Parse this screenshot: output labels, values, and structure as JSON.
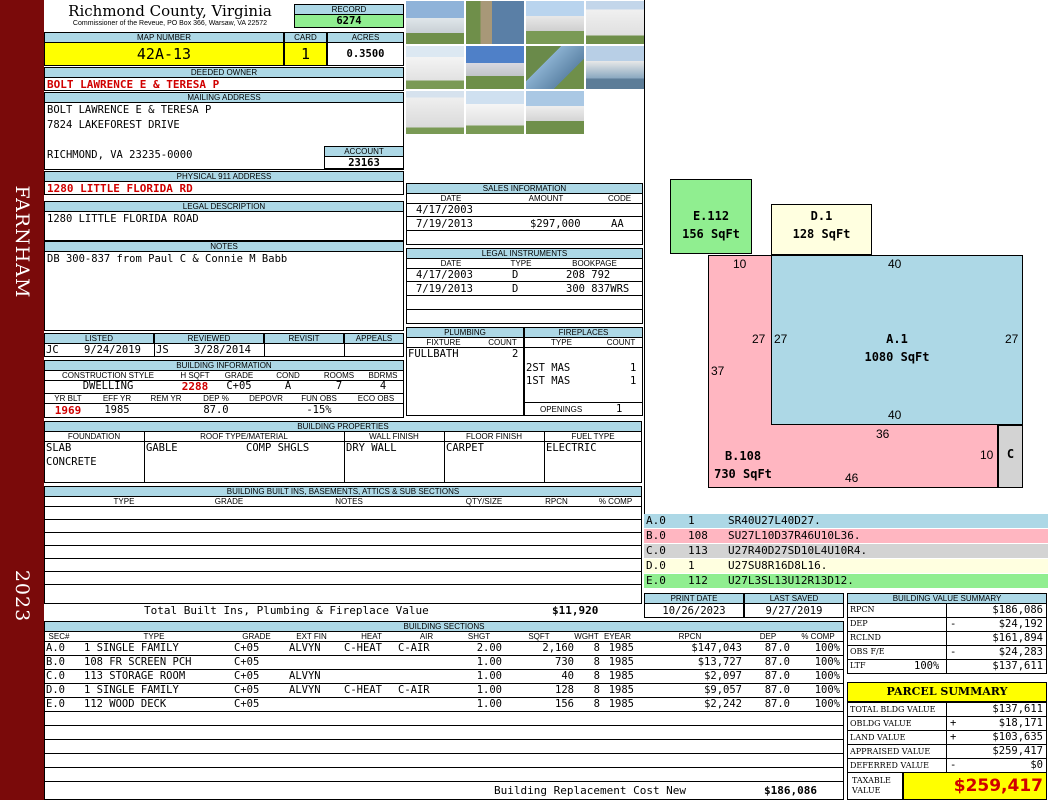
{
  "county": {
    "title": "Richmond County, Virginia",
    "subtitle": "Commissioner of the Reveue, PO Box 366, Warsaw, VA 22572"
  },
  "sidebar": {
    "district": "FARNHAM",
    "year": "2023"
  },
  "record": {
    "label": "RECORD",
    "value": "6274"
  },
  "map": {
    "label": "MAP NUMBER",
    "value": "42A-13",
    "card_label": "CARD",
    "card": "1",
    "acres_label": "ACRES",
    "acres": "0.3500"
  },
  "owner": {
    "label": "DEEDED OWNER",
    "value": "BOLT LAWRENCE E & TERESA P"
  },
  "mailing": {
    "label": "MAILING ADDRESS",
    "line1": "BOLT LAWRENCE E & TERESA P",
    "line2": "7824 LAKEFOREST DRIVE",
    "line3": "RICHMOND, VA 23235-0000"
  },
  "account": {
    "label": "ACCOUNT",
    "value": "23163"
  },
  "physical": {
    "label": "PHYSICAL 911 ADDRESS",
    "value": "1280 LITTLE FLORIDA RD"
  },
  "legal": {
    "label": "LEGAL DESCRIPTION",
    "value": "1280 LITTLE FLORIDA ROAD"
  },
  "notes": {
    "label": "NOTES",
    "value": "DB 300-837 from Paul C & Connie M Babb"
  },
  "listing": {
    "listed_label": "LISTED",
    "reviewed_label": "REVIEWED",
    "revisit_label": "REVISIT",
    "appeals_label": "APPEALS",
    "listed_by": "JC",
    "listed_date": "9/24/2019",
    "reviewed_by": "JS",
    "reviewed_date": "3/28/2014"
  },
  "building_info": {
    "label": "BUILDING INFORMATION",
    "h_style": "CONSTRUCTION STYLE",
    "h_hsqft": "H SQFT",
    "h_grade": "GRADE",
    "h_cond": "COND",
    "h_rooms": "ROOMS",
    "h_bdrms": "BDRMS",
    "style": "DWELLING",
    "hsqft": "2288",
    "grade": "C+05",
    "cond": "A",
    "rooms": "7",
    "bdrms": "4",
    "h_yrblt": "YR BLT",
    "h_effyr": "EFF YR",
    "h_remyr": "REM YR",
    "h_dep": "DEP %",
    "h_depovr": "DEPOVR",
    "h_funobs": "FUN OBS",
    "h_ecoobs": "ECO OBS",
    "yrblt": "1969",
    "effyr": "1985",
    "dep": "87.0",
    "funobs": "-15%"
  },
  "building_props": {
    "label": "BUILDING PROPERTIES",
    "h_found": "FOUNDATION",
    "h_roof": "ROOF TYPE/MATERIAL",
    "h_wall": "WALL FINISH",
    "h_floor": "FLOOR FINISH",
    "h_fuel": "FUEL TYPE",
    "found1": "SLAB",
    "found2": "CONCRETE",
    "roof_type": "GABLE",
    "roof_mat": "COMP SHGLS",
    "wall": "DRY WALL",
    "floor": "CARPET",
    "fuel": "ELECTRIC"
  },
  "builtins": {
    "label": "BUILDING BUILT INS, BASEMENTS, ATTICS & SUB SECTIONS",
    "h_type": "TYPE",
    "h_grade": "GRADE",
    "h_notes": "NOTES",
    "h_qty": "QTY/SIZE",
    "h_rpcn": "RPCN",
    "h_comp": "% COMP",
    "total_label": "Total Built Ins, Plumbing & Fireplace Value",
    "total": "$11,920"
  },
  "sales": {
    "label": "SALES INFORMATION",
    "h_date": "DATE",
    "h_amount": "AMOUNT",
    "h_code": "CODE",
    "rows": [
      {
        "date": "4/17/2003",
        "amount": "",
        "code": ""
      },
      {
        "date": "7/19/2013",
        "amount": "$297,000",
        "code": "AA"
      }
    ]
  },
  "instruments": {
    "label": "LEGAL INSTRUMENTS",
    "h_date": "DATE",
    "h_type": "TYPE",
    "h_book": "BOOKPAGE",
    "rows": [
      {
        "date": "4/17/2003",
        "type": "D",
        "book": "208 792"
      },
      {
        "date": "7/19/2013",
        "type": "D",
        "book": "300 837WRS"
      }
    ]
  },
  "plumbing": {
    "label": "PLUMBING",
    "h_fixture": "FIXTURE",
    "h_count": "COUNT",
    "fixture": "FULLBATH",
    "count": "2"
  },
  "fireplaces": {
    "label": "FIREPLACES",
    "h_type": "TYPE",
    "h_count": "COUNT",
    "rows": [
      {
        "type": "2ST MAS",
        "count": "1"
      },
      {
        "type": "1ST MAS",
        "count": "1"
      }
    ],
    "openings_label": "OPENINGS",
    "openings": "1"
  },
  "sketch": {
    "areas": [
      {
        "label": "E.112",
        "sqft": "156 SqFt",
        "color": "#90ee90"
      },
      {
        "label": "D.1",
        "sqft": "128 SqFt",
        "color": "#ffffe0"
      },
      {
        "label": "A.1",
        "sqft": "1080 SqFt",
        "color": "#add8e6"
      },
      {
        "label": "B.108",
        "sqft": "730 SqFt",
        "color": "#ffb6c1"
      },
      {
        "label": "C",
        "sqft": "",
        "color": "#d3d3d3"
      }
    ],
    "dims": {
      "d1": "10",
      "d2": "40",
      "d3": "27",
      "d4": "27",
      "d5": "27",
      "d6": "37",
      "d7": "40",
      "d8": "36",
      "d9": "10",
      "d10": "46"
    }
  },
  "legend": [
    {
      "sec": "A.0",
      "num": "1",
      "code": "SR40U27L40D27.",
      "color": "#add8e6"
    },
    {
      "sec": "B.0",
      "num": "108",
      "code": "SU27L10D37R46U10L36.",
      "color": "#ffb6c1"
    },
    {
      "sec": "C.0",
      "num": "113",
      "code": "U27R40D27SD10L4U10R4.",
      "color": "#d3d3d3"
    },
    {
      "sec": "D.0",
      "num": "1",
      "code": "U27SU8R16D8L16.",
      "color": "#ffffe0"
    },
    {
      "sec": "E.0",
      "num": "112",
      "code": "U27L3SL13U12R13D12.",
      "color": "#90ee90"
    }
  ],
  "dates": {
    "print_label": "PRINT DATE",
    "print": "10/26/2023",
    "saved_label": "LAST SAVED",
    "saved": "9/27/2019"
  },
  "sections": {
    "label": "BUILDING SECTIONS",
    "headers": [
      "SEC#",
      "TYPE",
      "GRADE",
      "EXT FIN",
      "HEAT",
      "AIR",
      "SHGT",
      "SQFT",
      "WGHT",
      "EYEAR",
      "RPCN",
      "DEP",
      "% COMP"
    ],
    "rows": [
      [
        "A.0",
        "1 SINGLE FAMILY",
        "C+05",
        "ALVYN",
        "C-HEAT",
        "C-AIR",
        "2.00",
        "2,160",
        "8",
        "1985",
        "$147,043",
        "87.0",
        "100%"
      ],
      [
        "B.0",
        "108 FR SCREEN PCH",
        "C+05",
        "",
        "",
        "",
        "1.00",
        "730",
        "8",
        "1985",
        "$13,727",
        "87.0",
        "100%"
      ],
      [
        "C.0",
        "113 STORAGE ROOM",
        "C+05",
        "ALVYN",
        "",
        "",
        "1.00",
        "40",
        "8",
        "1985",
        "$2,097",
        "87.0",
        "100%"
      ],
      [
        "D.0",
        "1 SINGLE FAMILY",
        "C+05",
        "ALVYN",
        "C-HEAT",
        "C-AIR",
        "1.00",
        "128",
        "8",
        "1985",
        "$9,057",
        "87.0",
        "100%"
      ],
      [
        "E.0",
        "112 WOOD DECK",
        "C+05",
        "",
        "",
        "",
        "1.00",
        "156",
        "8",
        "1985",
        "$2,242",
        "87.0",
        "100%"
      ]
    ],
    "replacement_label": "Building Replacement Cost New",
    "replacement": "$186,086"
  },
  "bvs": {
    "label": "BUILDING VALUE SUMMARY",
    "rows": [
      {
        "k": "RPCN",
        "s": "",
        "v": "$186,086"
      },
      {
        "k": "DEP",
        "s": "-",
        "v": "$24,192"
      },
      {
        "k": "RCLND",
        "s": "",
        "v": "$161,894"
      },
      {
        "k": "OBS F/E",
        "s": "-",
        "v": "$24,283"
      },
      {
        "k": "LTF",
        "pct": "100%",
        "s": "",
        "v": "$137,611"
      }
    ]
  },
  "parcel": {
    "label": "PARCEL SUMMARY",
    "rows": [
      {
        "k": "TOTAL BLDG VALUE",
        "s": "",
        "v": "$137,611"
      },
      {
        "k": "OBLDG VALUE",
        "s": "+",
        "v": "$18,171"
      },
      {
        "k": "LAND VALUE",
        "s": "+",
        "v": "$103,635"
      },
      {
        "k": "APPRAISED VALUE",
        "s": "",
        "v": "$259,417"
      },
      {
        "k": "DEFERRED VALUE",
        "s": "-",
        "v": "$0"
      }
    ],
    "taxable_label1": "TAXABLE",
    "taxable_label2": "VALUE",
    "taxable": "$259,417"
  },
  "photos": [
    "house-photo",
    "pier-photo",
    "house-photo",
    "shed-photo",
    "shed-photo",
    "house-photo",
    "waterfront-photo",
    "boathouse-photo",
    "shed-photo",
    "shed-photo",
    "house-photo"
  ]
}
